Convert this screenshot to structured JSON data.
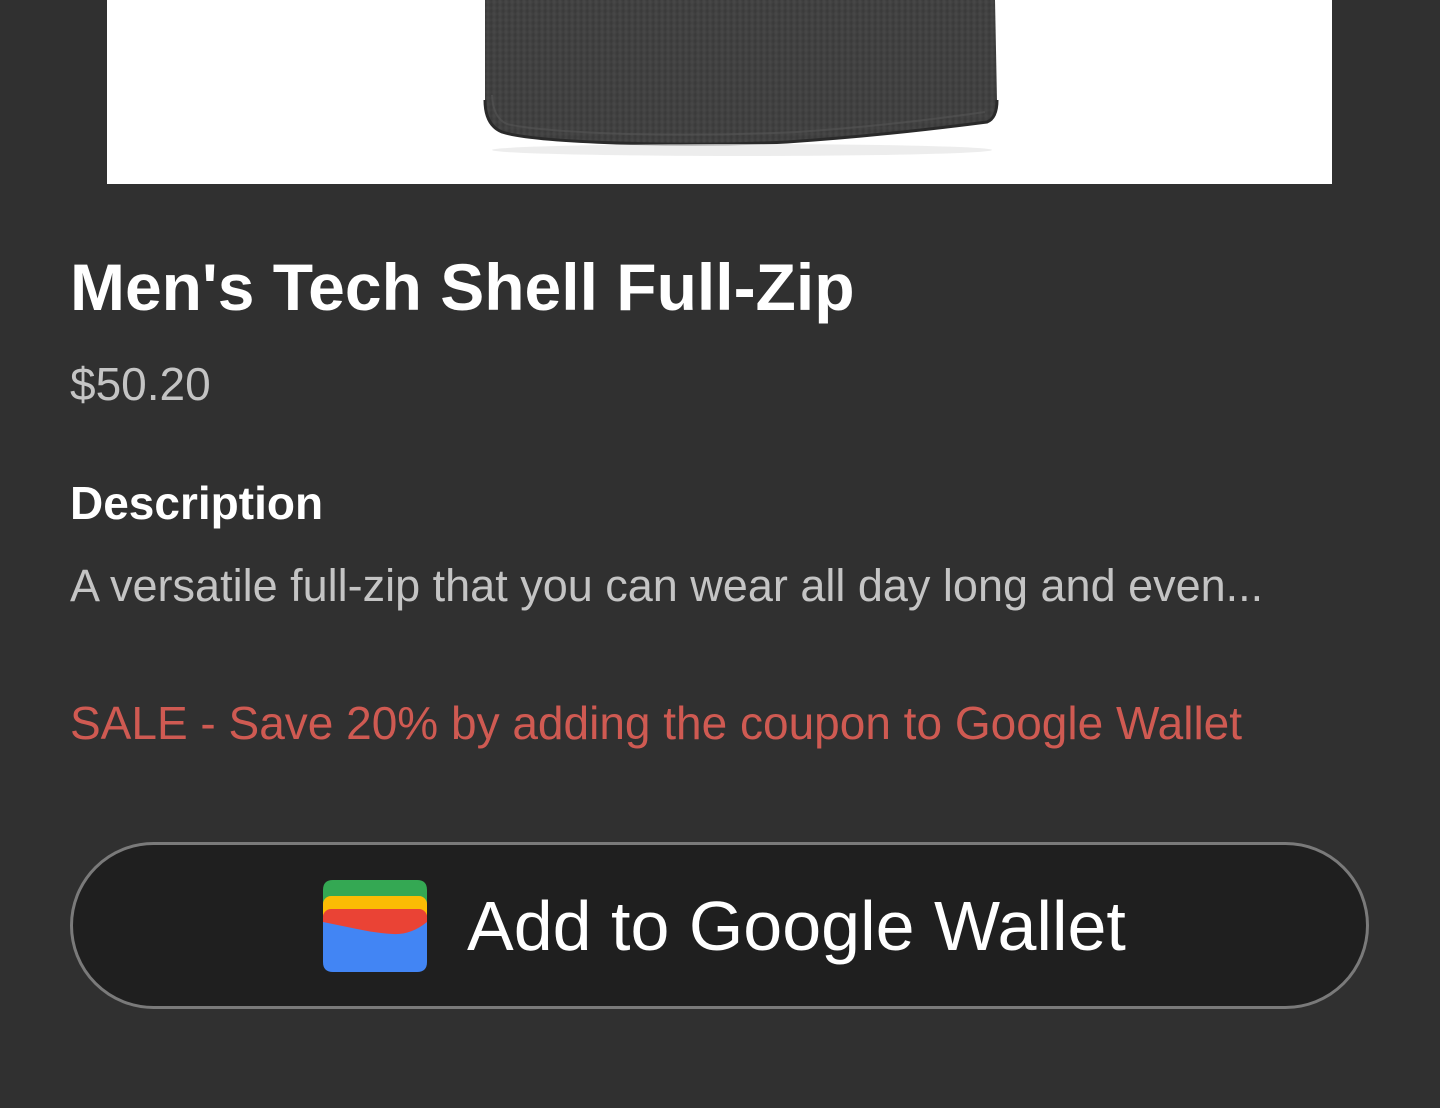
{
  "product": {
    "title": "Men's Tech Shell Full-Zip",
    "price": "$50.20",
    "description_heading": "Description",
    "description": "A versatile full-zip that you can wear all day long and even...",
    "sale_text": "SALE - Save 20% by adding the coupon to Google Wallet"
  },
  "wallet_button": {
    "label": "Add to Google Wallet",
    "icon": "google-wallet-icon"
  },
  "colors": {
    "background": "#303030",
    "sale": "#cf5a52",
    "button_bg": "#1f1f1f",
    "button_border": "#7a7a7a",
    "wallet_green": "#34a853",
    "wallet_yellow": "#fbbc04",
    "wallet_red": "#ea4335",
    "wallet_blue": "#4285f4"
  }
}
